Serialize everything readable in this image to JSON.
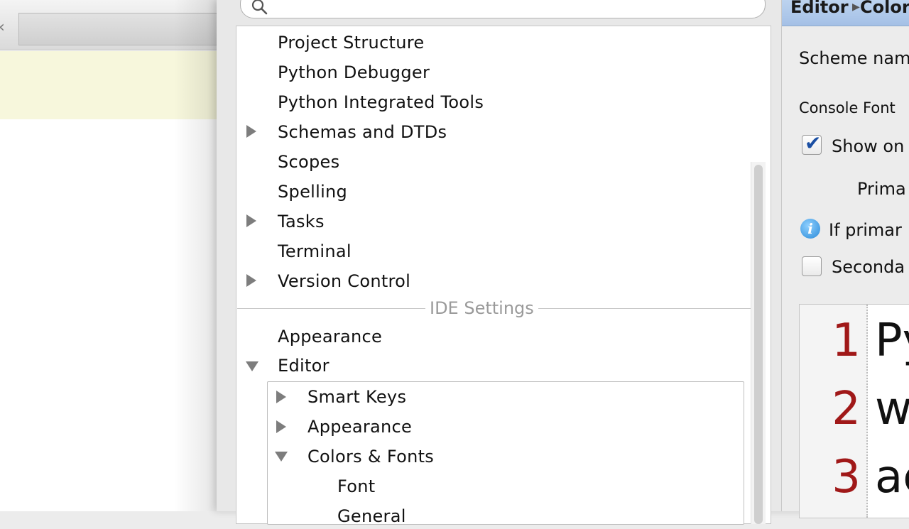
{
  "background": {
    "tab_close_glyph": "‹"
  },
  "search": {
    "placeholder": "",
    "value": ""
  },
  "tree": {
    "project_items": [
      {
        "label": "Project Structure",
        "expandable": false
      },
      {
        "label": "Python Debugger",
        "expandable": false
      },
      {
        "label": "Python Integrated Tools",
        "expandable": false
      },
      {
        "label": "Schemas and DTDs",
        "expandable": true
      },
      {
        "label": "Scopes",
        "expandable": false
      },
      {
        "label": "Spelling",
        "expandable": false
      },
      {
        "label": "Tasks",
        "expandable": true
      },
      {
        "label": "Terminal",
        "expandable": false
      },
      {
        "label": "Version Control",
        "expandable": true
      }
    ],
    "section_label": "IDE Settings",
    "ide_items": [
      {
        "label": "Appearance",
        "expandable": false
      },
      {
        "label": "Editor",
        "expanded": true
      }
    ],
    "editor_children": [
      {
        "label": "Smart Keys",
        "expandable": true
      },
      {
        "label": "Appearance",
        "expandable": true
      },
      {
        "label": "Colors & Fonts",
        "expanded": true
      },
      {
        "label": "Font"
      },
      {
        "label": "General"
      }
    ]
  },
  "right": {
    "breadcrumb": [
      "Editor",
      "Colors & Fonts"
    ],
    "scheme_name_label": "Scheme nam",
    "console_font_label": "Console Font",
    "show_only_label": "Show on",
    "show_only_checked": true,
    "primary_font_label": "Prima",
    "info_text": "If primar",
    "secondary_label": "Seconda",
    "secondary_checked": false,
    "preview_lines": [
      {
        "num": "1",
        "text": "Py"
      },
      {
        "num": "2",
        "text": "wi"
      },
      {
        "num": "3",
        "text": "ac"
      }
    ]
  },
  "colors": {
    "accent": "#a4c0e6",
    "line_number": "#a01818",
    "arrow": "#7d7d7d"
  }
}
